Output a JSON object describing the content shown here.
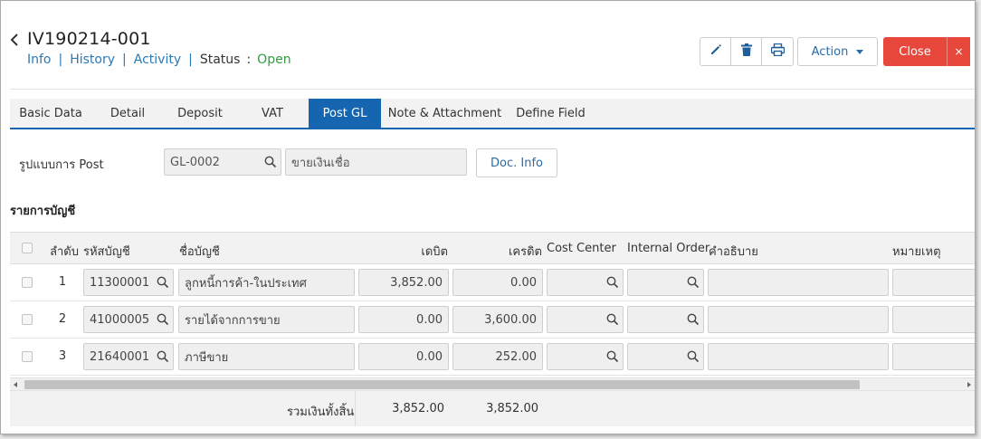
{
  "header": {
    "doc_no": "IV190214-001",
    "links": {
      "info": "Info",
      "history": "History",
      "activity": "Activity"
    },
    "status_label": "Status",
    "status_colon": ":",
    "status_value": "Open",
    "separator": "|",
    "action_label": "Action",
    "close_label": "Close",
    "close_x": "×",
    "icons": [
      "pencil-icon",
      "trash-icon",
      "printer-icon"
    ]
  },
  "tabs": [
    {
      "label": "Basic Data",
      "active": false
    },
    {
      "label": "Detail",
      "active": false
    },
    {
      "label": "Deposit",
      "active": false
    },
    {
      "label": "VAT",
      "active": false
    },
    {
      "label": "Post GL",
      "active": true
    },
    {
      "label": "Note & Attachment",
      "active": false
    },
    {
      "label": "Define Field",
      "active": false
    }
  ],
  "post_gl": {
    "format_label": "รูปแบบการ Post",
    "format_code": "GL-0002",
    "format_name": "ขายเงินเชื่อ",
    "doc_info_label": "Doc. Info"
  },
  "accounts": {
    "title": "รายการบัญชี",
    "columns": {
      "seq": "ลำดับ",
      "code": "รหัสบัญชี",
      "name": "ชื่อบัญชี",
      "debit": "เดบิต",
      "credit": "เครดิต",
      "cost_center": "Cost Center",
      "internal_order": "Internal Order",
      "description": "คำอธิบาย",
      "remark": "หมายเหตุ"
    },
    "rows": [
      {
        "seq": "1",
        "code": "11300001",
        "name": "ลูกหนี้การค้า-ในประเทศ",
        "debit": "3,852.00",
        "credit": "0.00",
        "cost_center": "",
        "internal_order": "",
        "description": "",
        "remark": ""
      },
      {
        "seq": "2",
        "code": "41000005",
        "name": "รายได้จากการขาย",
        "debit": "0.00",
        "credit": "3,600.00",
        "cost_center": "",
        "internal_order": "",
        "description": "",
        "remark": ""
      },
      {
        "seq": "3",
        "code": "21640001",
        "name": "ภาษีขาย",
        "debit": "0.00",
        "credit": "252.00",
        "cost_center": "",
        "internal_order": "",
        "description": "",
        "remark": ""
      }
    ],
    "footer": {
      "label": "รวมเงินทั้งสิ้น",
      "total_debit": "3,852.00",
      "total_credit": "3,852.00"
    }
  },
  "colors": {
    "link": "#2a7ab8",
    "status_open": "#2f9d3e",
    "tab_active": "#1565b0",
    "close": "#e8483b"
  }
}
